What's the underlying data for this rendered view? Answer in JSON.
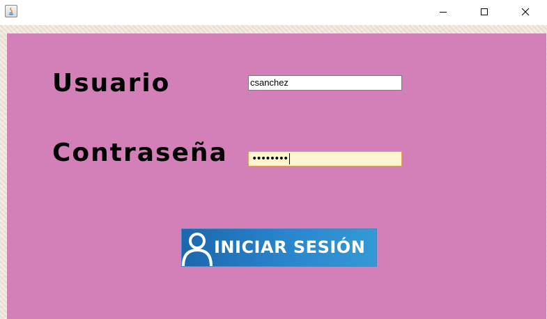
{
  "window": {
    "icon": "java-icon",
    "controls": {
      "minimize": "minimize-icon",
      "maximize": "maximize-icon",
      "close": "close-icon"
    }
  },
  "form": {
    "user_label": "Usuario",
    "user_value": "csanchez",
    "password_label": "Contraseña",
    "password_masked": "••••••••",
    "login_button": "INICIAR SESIÓN",
    "login_icon": "user-icon"
  },
  "colors": {
    "panel": "#d37fb8",
    "password_field_bg": "#fff6cf",
    "button_blue": "#2a86cc"
  }
}
